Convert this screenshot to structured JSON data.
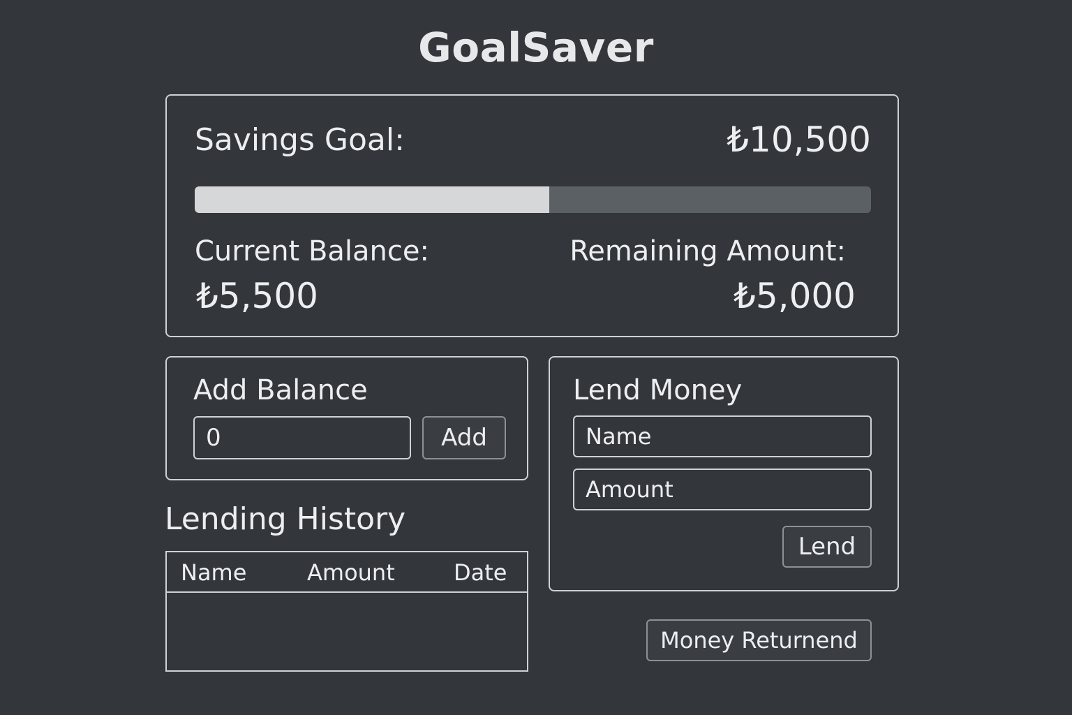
{
  "app": {
    "title": "GoalSaver"
  },
  "goal": {
    "label": "Savings Goal:",
    "value": "₺10,500",
    "progress_fraction": 0.524,
    "balance_label": "Current Balance:",
    "balance_value": "₺5,500",
    "remaining_label": "Remaining Amount:",
    "remaining_value": "₺5,000"
  },
  "add_balance": {
    "title": "Add Balance",
    "input_value": "0",
    "button_label": "Add"
  },
  "lend_money": {
    "title": "Lend Money",
    "name_placeholder": "Name",
    "amount_placeholder": "Amount",
    "button_label": "Lend"
  },
  "lending_history": {
    "title": "Lending History",
    "columns": [
      "Name",
      "Amount",
      "Date"
    ],
    "rows": []
  },
  "actions": {
    "money_returned_label": "Money Returnend"
  },
  "colors": {
    "background": "#33373c",
    "progress_fill": "#d6d7d8",
    "progress_track": "#5b6064",
    "border": "#cfd2d5"
  }
}
